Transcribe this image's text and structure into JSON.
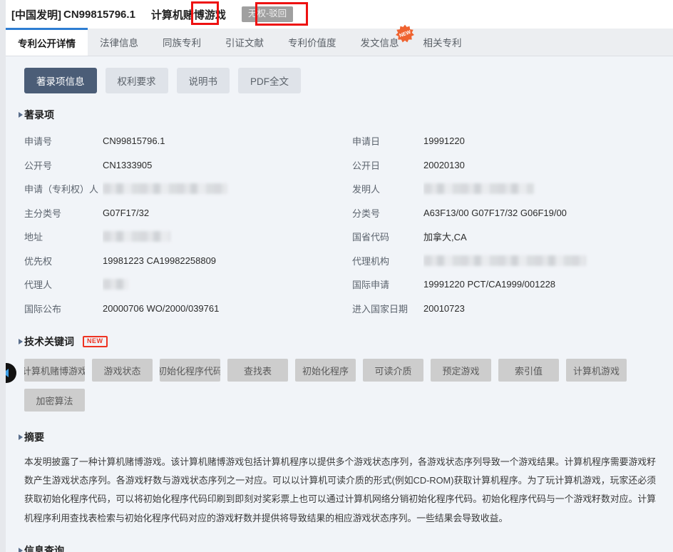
{
  "header": {
    "kind": "[中国发明]",
    "application_number": "CN99815796.1",
    "title": "计算机赌博游戏",
    "status": "无权-驳回"
  },
  "tabs": [
    {
      "label": "专利公开详情",
      "active": true,
      "badge": null
    },
    {
      "label": "法律信息",
      "active": false,
      "badge": null
    },
    {
      "label": "同族专利",
      "active": false,
      "badge": null
    },
    {
      "label": "引证文献",
      "active": false,
      "badge": null
    },
    {
      "label": "专利价值度",
      "active": false,
      "badge": null
    },
    {
      "label": "发文信息",
      "active": false,
      "badge": "NEW"
    },
    {
      "label": "相关专利",
      "active": false,
      "badge": null
    }
  ],
  "subtabs": [
    {
      "label": "著录项信息",
      "active": true
    },
    {
      "label": "权利要求",
      "active": false
    },
    {
      "label": "说明书",
      "active": false
    },
    {
      "label": "PDF全文",
      "active": false
    }
  ],
  "sections": {
    "biblio_title": "著录项",
    "keywords_title": "技术关键词",
    "keywords_badge": "NEW",
    "abstract_title": "摘要",
    "info_query_title": "信息查询"
  },
  "biblio_rows": [
    {
      "l1": "申请号",
      "v1": "CN99815796.1",
      "v1_redacted": false,
      "v1_w": 0,
      "l2": "申请日",
      "v2": "19991220",
      "v2_redacted": false,
      "v2_w": 0
    },
    {
      "l1": "公开号",
      "v1": "CN1333905",
      "v1_redacted": false,
      "v1_w": 0,
      "l2": "公开日",
      "v2": "20020130",
      "v2_redacted": false,
      "v2_w": 0
    },
    {
      "l1": "申请（专利权）人",
      "v1": "",
      "v1_redacted": true,
      "v1_w": 175,
      "l2": "发明人",
      "v2": "",
      "v2_redacted": true,
      "v2_w": 155
    },
    {
      "l1": "主分类号",
      "v1": "G07F17/32",
      "v1_redacted": false,
      "v1_w": 0,
      "l2": "分类号",
      "v2": "A63F13/00 G07F17/32 G06F19/00",
      "v2_redacted": false,
      "v2_w": 0
    },
    {
      "l1": "地址",
      "v1": "",
      "v1_redacted": true,
      "v1_w": 95,
      "l2": "国省代码",
      "v2": "加拿大,CA",
      "v2_redacted": false,
      "v2_w": 0
    },
    {
      "l1": "优先权",
      "v1": "19981223 CA19982258809",
      "v1_redacted": false,
      "v1_w": 0,
      "l2": "代理机构",
      "v2": "",
      "v2_redacted": true,
      "v2_w": 228
    },
    {
      "l1": "代理人",
      "v1": "",
      "v1_redacted": true,
      "v1_w": 36,
      "l2": "国际申请",
      "v2": "19991220 PCT/CA1999/001228",
      "v2_redacted": false,
      "v2_w": 0
    },
    {
      "l1": "国际公布",
      "v1": "20000706 WO/2000/039761",
      "v1_redacted": false,
      "v1_w": 0,
      "l2": "进入国家日期",
      "v2": "20010723",
      "v2_redacted": false,
      "v2_w": 0
    }
  ],
  "keywords": [
    "计算机赌博游戏",
    "游戏状态",
    "初始化程序代码",
    "查找表",
    "初始化程序",
    "可读介质",
    "预定游戏",
    "索引值",
    "计算机游戏",
    "加密算法"
  ],
  "abstract_text": "本发明披露了一种计算机赌博游戏。该计算机赌博游戏包括计算机程序以提供多个游戏状态序列，各游戏状态序列导致一个游戏结果。计算机程序需要游戏籽数产生游戏状态序列。各游戏籽数与游戏状态序列之一对应。可以以计算机可读介质的形式(例如CD-ROM)获取计算机程序。为了玩计算机游戏，玩家还必须获取初始化程序代码，可以将初始化程序代码印刷到即刻对奖彩票上也可以通过计算机网络分销初始化程序代码。初始化程序代码与一个游戏籽数对应。计算机程序利用查找表检索与初始化程序代码对应的游戏籽数并提供将导致结果的相应游戏状态序列。一些结果会导致收益。",
  "annotations": [
    {
      "name": "annot-title-box"
    },
    {
      "name": "annot-status-box"
    }
  ],
  "colors": {
    "accent_blue": "#2d7dd2",
    "subtab_active": "#4b5d77",
    "status_badge_bg": "#a0a0a0",
    "annotation_red": "#ee1111",
    "new_badge": "#ee3322",
    "panel_bg": "#f1f4f8"
  }
}
